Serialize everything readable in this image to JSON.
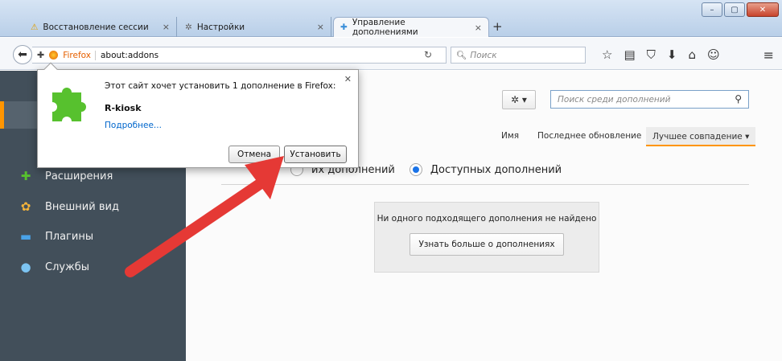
{
  "window": {
    "tabs": [
      {
        "label": "Восстановление сессии",
        "icon": "warning-icon"
      },
      {
        "label": "Настройки",
        "icon": "gear-icon"
      },
      {
        "label": "Управление дополнениями",
        "icon": "puzzle-icon"
      }
    ],
    "new_tab": "+"
  },
  "navbar": {
    "identity": "Firefox",
    "url": "about:addons",
    "search_placeholder": "Поиск"
  },
  "sidebar": {
    "items": [
      {
        "label": "Расширения",
        "icon": "puzzle-icon"
      },
      {
        "label": "Внешний вид",
        "icon": "palette-icon"
      },
      {
        "label": "Плагины",
        "icon": "plugin-icon"
      },
      {
        "label": "Службы",
        "icon": "speech-bubble-icon"
      }
    ]
  },
  "main": {
    "search_placeholder": "Поиск среди дополнений",
    "sort": {
      "name": "Имя",
      "last_update": "Последнее обновление",
      "best_match": "Лучшее совпадение"
    },
    "filter": {
      "installed_label": "их дополнений",
      "available_label": "Доступных дополнений"
    },
    "empty": {
      "message": "Ни одного подходящего дополнения не найдено",
      "learn_more": "Узнать больше о дополнениях"
    }
  },
  "popup": {
    "message": "Этот сайт хочет установить 1 дополнение в Firefox:",
    "addon_name": "R-kiosk",
    "more_link": "Подробнее...",
    "cancel": "Отмена",
    "install": "Установить"
  },
  "colors": {
    "sidebar_bg": "#424f5a",
    "accent": "#ff9500",
    "link": "#0066cc",
    "arrow": "#e53935",
    "puzzle": "#57c12e"
  }
}
